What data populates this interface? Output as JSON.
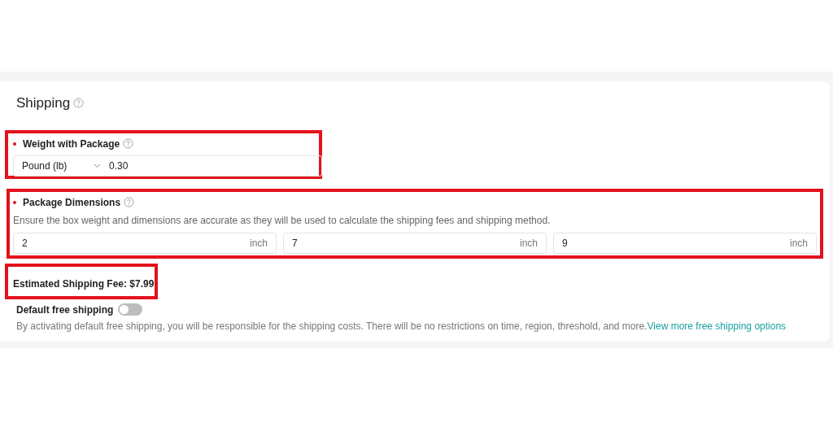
{
  "section": {
    "title": "Shipping"
  },
  "weight": {
    "label": "Weight with Package",
    "required": true,
    "highlighted": true,
    "unit": "Pound (lb)",
    "value": "0.30"
  },
  "dimensions": {
    "label": "Package Dimensions",
    "required": true,
    "highlighted": true,
    "hint": "Ensure the box weight and dimensions are accurate as they will be used to calculate the shipping fees and shipping method.",
    "fields": [
      {
        "value": "2",
        "unit": "inch"
      },
      {
        "value": "7",
        "unit": "inch"
      },
      {
        "value": "9",
        "unit": "inch"
      }
    ]
  },
  "fee": {
    "text": "Estimated Shipping Fee: $7.99",
    "highlighted": true
  },
  "free_shipping": {
    "label": "Default free shipping",
    "on": false,
    "description": "By activating default free shipping, you will be responsible for the shipping costs. There will be no restrictions on time, region, threshold, and more.",
    "link": "View more free shipping options"
  }
}
